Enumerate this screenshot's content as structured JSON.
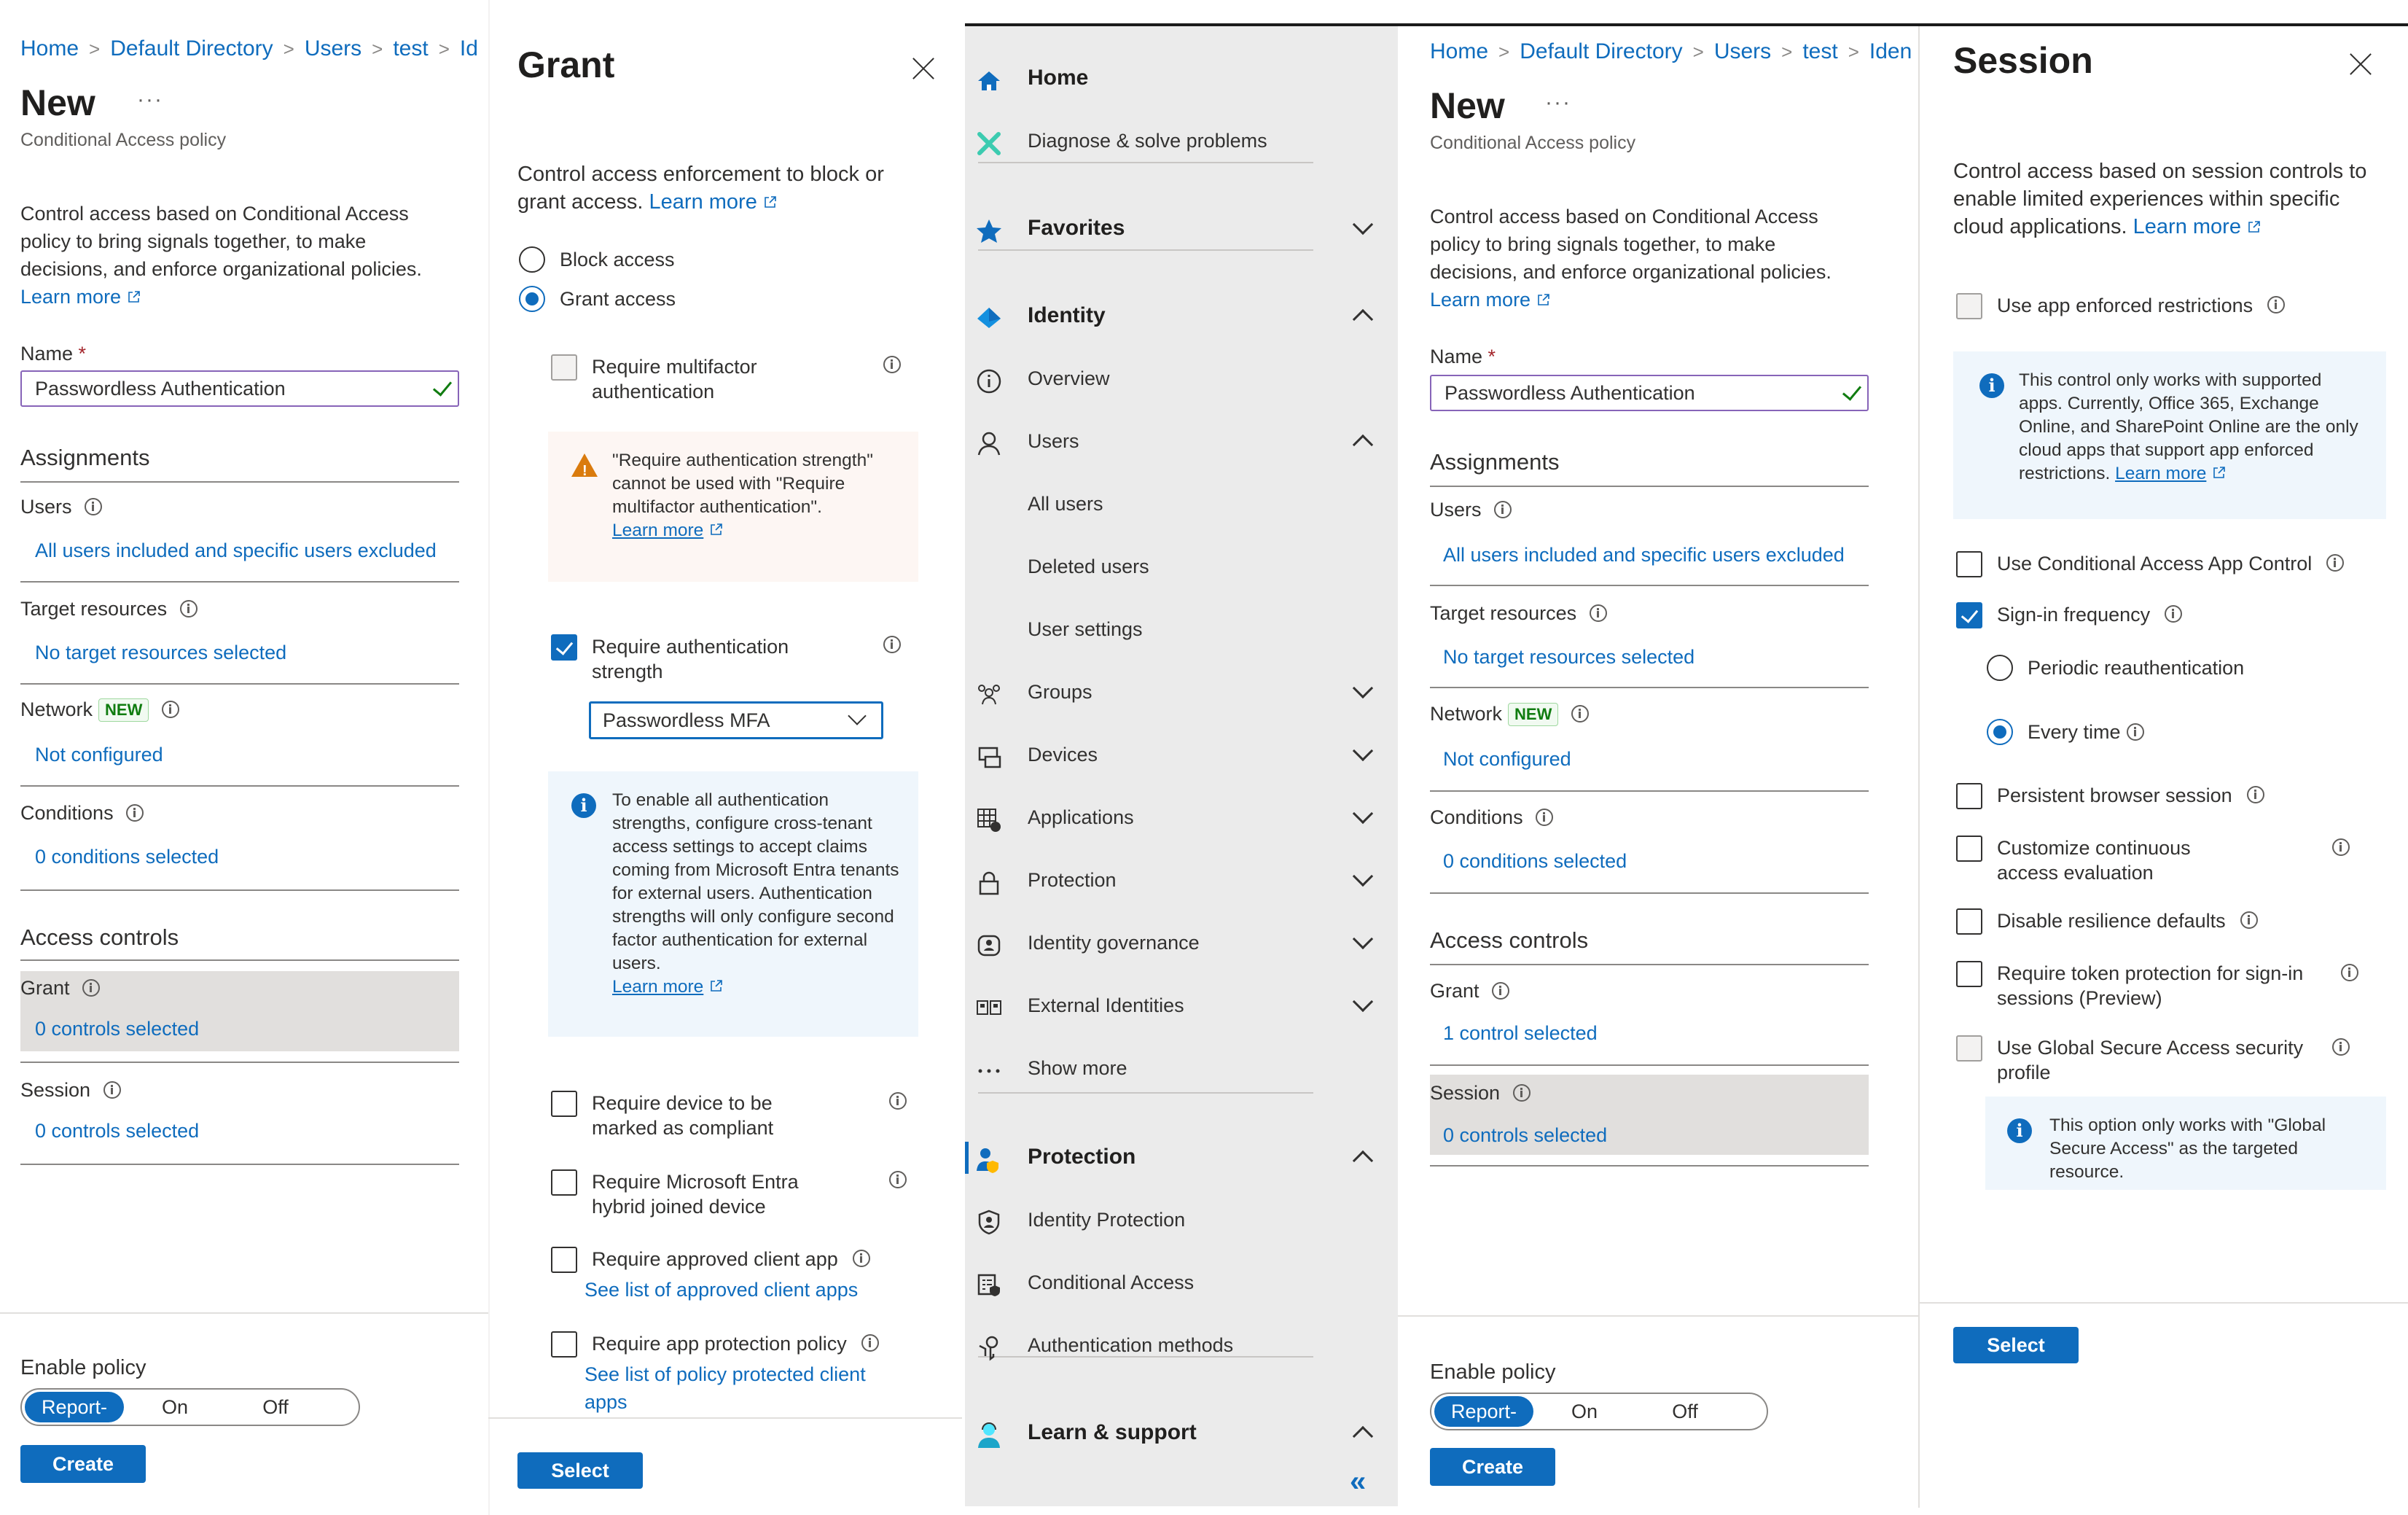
{
  "panel_new_left": {
    "breadcrumb": [
      "Home",
      "Default Directory",
      "Users",
      "test",
      "Id"
    ],
    "title": "New",
    "more": "···",
    "subtitle": "Conditional Access policy",
    "description": "Control access based on Conditional Access policy to bring signals together, to make decisions, and enforce organizational policies.",
    "learn_more": "Learn more",
    "name_label": "Name",
    "required_mark": "*",
    "name_value": "Passwordless Authentication",
    "assignments_heading": "Assignments",
    "users_label": "Users",
    "users_value": "All users included and specific users excluded",
    "target_label": "Target resources",
    "target_value": "No target resources selected",
    "network_label": "Network",
    "network_badge": "NEW",
    "network_value": "Not configured",
    "conditions_label": "Conditions",
    "conditions_value": "0 conditions selected",
    "access_heading": "Access controls",
    "grant_label": "Grant",
    "grant_value": "0 controls selected",
    "session_label": "Session",
    "session_value": "0 controls selected",
    "enable_label": "Enable policy",
    "toggle": [
      "Report-only",
      "On",
      "Off"
    ],
    "toggle_selected": "Report-only",
    "create_label": "Create"
  },
  "panel_grant": {
    "title": "Grant",
    "description": "Control access enforcement to block or grant access.",
    "learn_more": "Learn more",
    "radio_block": "Block access",
    "radio_grant": "Grant access",
    "radio_selected": "Grant access",
    "opt_mfa": "Require multifactor authentication",
    "opt_mfa_checked": false,
    "warning_text": "\"Require authentication strength\" cannot be used with \"Require multifactor authentication\".",
    "warning_link": "Learn more",
    "opt_strength": "Require authentication strength",
    "opt_strength_checked": true,
    "strength_dropdown": "Passwordless MFA",
    "info_text": "To enable all authentication strengths, configure cross-tenant access settings to accept claims coming from Microsoft Entra tenants for external users. Authentication strengths will only configure second factor authentication for external users.",
    "info_link": "Learn more",
    "opt_compliant": "Require device to be marked as compliant",
    "opt_hybrid": "Require Microsoft Entra hybrid joined device",
    "opt_approved": "Require approved client app",
    "approved_link": "See list of approved client apps",
    "opt_app_protection": "Require app protection policy",
    "app_protection_link": "See list of policy protected client apps",
    "select_label": "Select"
  },
  "nav": {
    "items": [
      {
        "label": "Home",
        "icon": "home-icon",
        "bold": true
      },
      {
        "label": "Diagnose & solve problems",
        "icon": "wrench-icon"
      },
      {
        "label": "Favorites",
        "icon": "star-icon",
        "bold": true,
        "chevron": "down"
      },
      {
        "label": "Identity",
        "icon": "identity-diamond-icon",
        "bold": true,
        "chevron": "up"
      },
      {
        "label": "Overview",
        "icon": "info-icon"
      },
      {
        "label": "Users",
        "icon": "user-icon",
        "chevron": "up"
      },
      {
        "label": "All users"
      },
      {
        "label": "Deleted users"
      },
      {
        "label": "User settings"
      },
      {
        "label": "Groups",
        "icon": "groups-icon",
        "chevron": "down"
      },
      {
        "label": "Devices",
        "icon": "devices-icon",
        "chevron": "down"
      },
      {
        "label": "Applications",
        "icon": "applications-icon",
        "chevron": "down"
      },
      {
        "label": "Protection",
        "icon": "lock-icon",
        "chevron": "down"
      },
      {
        "label": "Identity governance",
        "icon": "governance-icon",
        "chevron": "down"
      },
      {
        "label": "External Identities",
        "icon": "external-identities-icon",
        "chevron": "down"
      },
      {
        "label": "Show more",
        "icon": "more-icon"
      },
      {
        "label": "Protection",
        "icon": "protection-user-shield-icon",
        "bold": true,
        "chevron": "up",
        "active": true
      },
      {
        "label": "Identity Protection",
        "icon": "shield-user-icon"
      },
      {
        "label": "Conditional Access",
        "icon": "conditional-access-icon"
      },
      {
        "label": "Authentication methods",
        "icon": "key-icon"
      },
      {
        "label": "Learn & support",
        "icon": "support-icon",
        "bold": true,
        "chevron": "up"
      }
    ],
    "collapse": "«"
  },
  "panel_new_right": {
    "breadcrumb": [
      "Home",
      "Default Directory",
      "Users",
      "test",
      "Iden"
    ],
    "title": "New",
    "more": "···",
    "subtitle": "Conditional Access policy",
    "description": "Control access based on Conditional Access policy to bring signals together, to make decisions, and enforce organizational policies.",
    "learn_more": "Learn more",
    "name_label": "Name",
    "required_mark": "*",
    "name_value": "Passwordless Authentication",
    "assignments_heading": "Assignments",
    "users_label": "Users",
    "users_value": "All users included and specific users excluded",
    "target_label": "Target resources",
    "target_value": "No target resources selected",
    "network_label": "Network",
    "network_badge": "NEW",
    "network_value": "Not configured",
    "conditions_label": "Conditions",
    "conditions_value": "0 conditions selected",
    "access_heading": "Access controls",
    "grant_label": "Grant",
    "grant_value": "1 control selected",
    "session_label": "Session",
    "session_value": "0 controls selected",
    "enable_label": "Enable policy",
    "toggle": [
      "Report-only",
      "On",
      "Off"
    ],
    "toggle_selected": "Report-only",
    "create_label": "Create"
  },
  "panel_session": {
    "title": "Session",
    "description": "Control access based on session controls to enable limited experiences within specific cloud applications.",
    "learn_more": "Learn more",
    "opt_app_enforced": "Use app enforced restrictions",
    "app_enforced_info": "This control only works with supported apps. Currently, Office 365, Exchange Online, and SharePoint Online are the only cloud apps that support app enforced restrictions.",
    "app_enforced_link": "Learn more",
    "opt_app_control": "Use Conditional Access App Control",
    "opt_signin_freq": "Sign-in frequency",
    "opt_signin_freq_checked": true,
    "radio_periodic": "Periodic reauthentication",
    "radio_every_time": "Every time",
    "radio_selected": "Every time",
    "opt_persistent": "Persistent browser session",
    "opt_cae": "Customize continuous access evaluation",
    "opt_resilience": "Disable resilience defaults",
    "opt_token": "Require token protection for sign-in sessions (Preview)",
    "opt_gsa": "Use Global Secure Access security profile",
    "gsa_info": "This option only works with \"Global Secure Access\" as the targeted resource.",
    "select_label": "Select"
  }
}
